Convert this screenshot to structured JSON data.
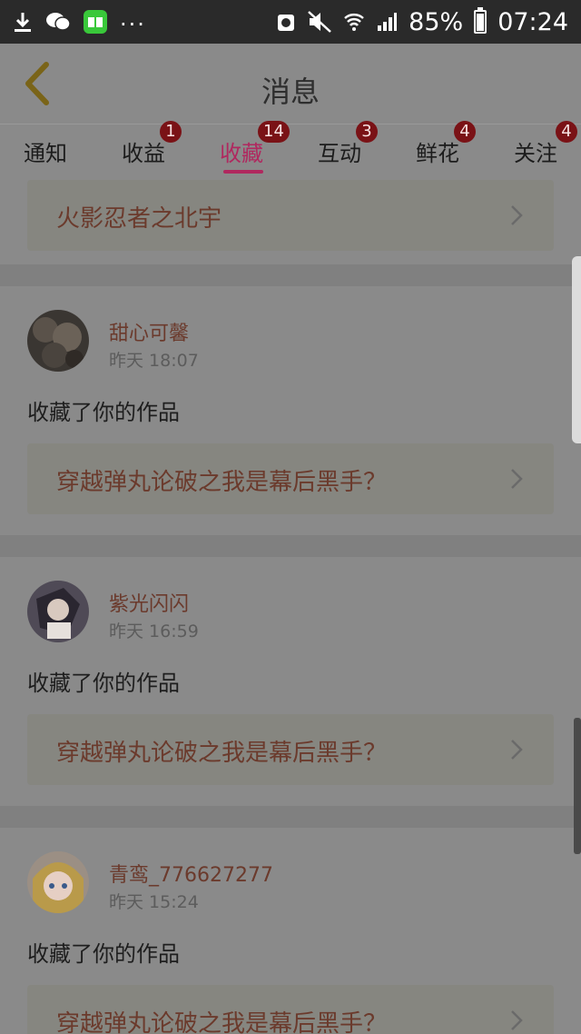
{
  "statusbar": {
    "icons": [
      "download-icon",
      "wechat-icon",
      "reader-app-icon"
    ],
    "more": "...",
    "battery_percent": "85%",
    "time": "07:24",
    "battery_level": 0.85
  },
  "header": {
    "title": "消息"
  },
  "tabs": [
    {
      "label": "通知",
      "badge": ""
    },
    {
      "label": "收益",
      "badge": "1"
    },
    {
      "label": "收藏",
      "badge": "14",
      "active": true
    },
    {
      "label": "互动",
      "badge": "3"
    },
    {
      "label": "鲜花",
      "badge": "4"
    },
    {
      "label": "关注",
      "badge": "4"
    }
  ],
  "top_card": {
    "title": "火影忍者之北宇"
  },
  "items": [
    {
      "username": "甜心可馨",
      "time": "昨天 18:07",
      "action": "收藏了你的作品",
      "work": "穿越弹丸论破之我是幕后黑手？"
    },
    {
      "username": "紫光闪闪",
      "time": "昨天 16:59",
      "action": "收藏了你的作品",
      "work": "穿越弹丸论破之我是幕后黑手？"
    },
    {
      "username": "青鸾_776627277",
      "time": "昨天 15:24",
      "action": "收藏了你的作品",
      "work": "穿越弹丸论破之我是幕后黑手？"
    }
  ],
  "colors": {
    "accent": "#b0285f",
    "badge": "#7a1216",
    "link": "#6b3a2c"
  }
}
